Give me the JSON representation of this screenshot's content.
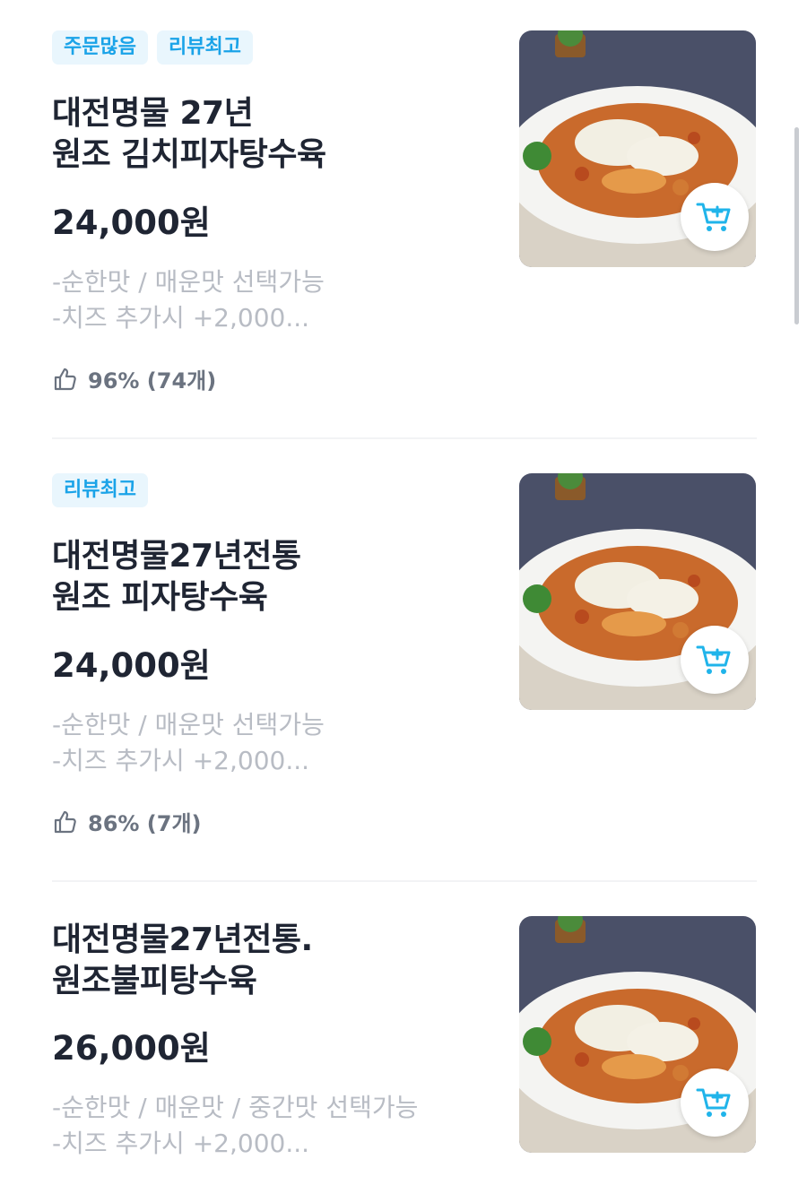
{
  "menu": {
    "items": [
      {
        "badges": [
          "주문많음",
          "리뷰최고"
        ],
        "title_lines": [
          "대전명물 27년",
          "원조 김치피자탕수육"
        ],
        "price": "24,000원",
        "desc_lines": [
          "-순한맛 / 매운맛 선택가능",
          "-치즈 추가시 +2,000..."
        ],
        "rating": "96% (74개)",
        "image_icon": "fried-pork-cheese-photo",
        "cart_icon": "cart-add-icon"
      },
      {
        "badges": [
          "리뷰최고"
        ],
        "title_lines": [
          "대전명물27년전통",
          "원조 피자탕수육"
        ],
        "price": "24,000원",
        "desc_lines": [
          "-순한맛 / 매운맛 선택가능",
          "-치즈 추가시 +2,000..."
        ],
        "rating": "86% (7개)",
        "image_icon": "fried-pork-cheese-photo",
        "cart_icon": "cart-add-icon"
      },
      {
        "badges": [],
        "title_lines": [
          "대전명물27년전통.",
          "원조불피탕수육"
        ],
        "price": "26,000원",
        "desc_lines": [
          "-순한맛 / 매운맛 / 중간맛 선택가능",
          "-치즈 추가시 +2,000..."
        ],
        "rating": "",
        "image_icon": "fried-pork-cheese-photo",
        "cart_icon": "cart-add-icon"
      }
    ]
  },
  "colors": {
    "badge_text": "#1aa3e8",
    "badge_bg": "#e9f6fd",
    "cart_accent": "#20b4ea",
    "title": "#1f2533",
    "desc": "#b8bcc4",
    "rating": "#6b7380"
  }
}
